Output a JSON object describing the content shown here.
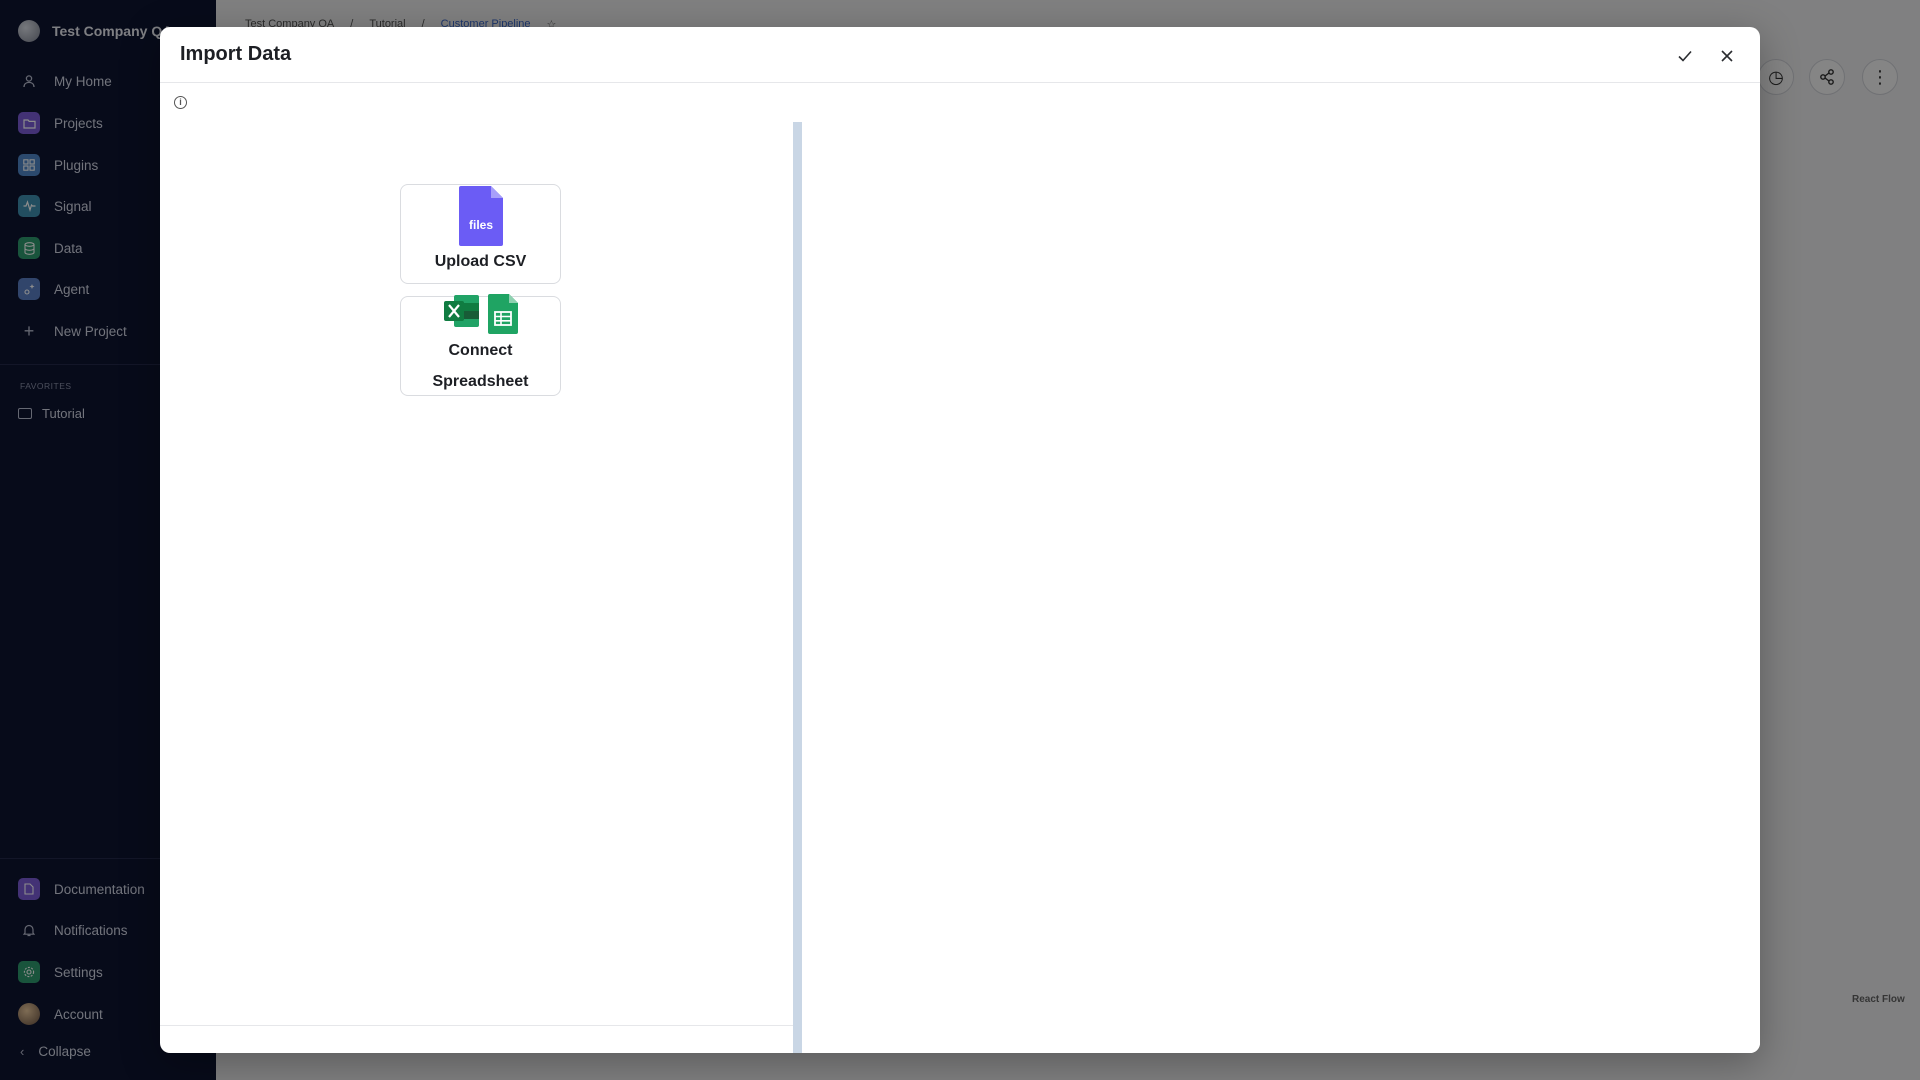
{
  "sidebar": {
    "org_name": "Test Company QA",
    "nav": [
      {
        "label": "My Home",
        "icon": "user-icon"
      },
      {
        "label": "Projects",
        "icon": "folder-icon"
      },
      {
        "label": "Plugins",
        "icon": "grid-icon"
      },
      {
        "label": "Signal",
        "icon": "signal-icon"
      },
      {
        "label": "Data",
        "icon": "database-icon"
      },
      {
        "label": "Agent",
        "icon": "agent-icon"
      },
      {
        "label": "New Project",
        "icon": "plus-icon"
      }
    ],
    "favorites_label": "FAVORITES",
    "favorites": [
      {
        "label": "Tutorial",
        "icon": "folder-icon"
      }
    ],
    "bottom": [
      {
        "label": "Documentation",
        "icon": "document-icon"
      },
      {
        "label": "Notifications",
        "icon": "bell-icon"
      },
      {
        "label": "Settings",
        "icon": "gear-icon"
      },
      {
        "label": "Account",
        "icon": "avatar"
      }
    ],
    "collapse_label": "Collapse"
  },
  "background": {
    "breadcrumb": [
      "Test Company QA",
      "/",
      "Tutorial",
      "/",
      "Customer Pipeline"
    ],
    "react_flow_label": "React Flow"
  },
  "modal": {
    "title": "Import Data",
    "confirm_icon": "check-icon",
    "close_icon": "close-icon",
    "info_icon": "info-icon",
    "options": [
      {
        "label": "Upload CSV",
        "icon": "files-icon",
        "icon_text": "files"
      },
      {
        "label": "Connect Spreadsheet",
        "icons": [
          "excel-icon",
          "google-sheets-icon"
        ]
      }
    ]
  },
  "colors": {
    "sidebar_bg": "#0e1430",
    "files_icon": "#6b5cf5",
    "excel": "#1f7a45",
    "sheets": "#1fa463",
    "splitter": "#c9d6e5"
  }
}
